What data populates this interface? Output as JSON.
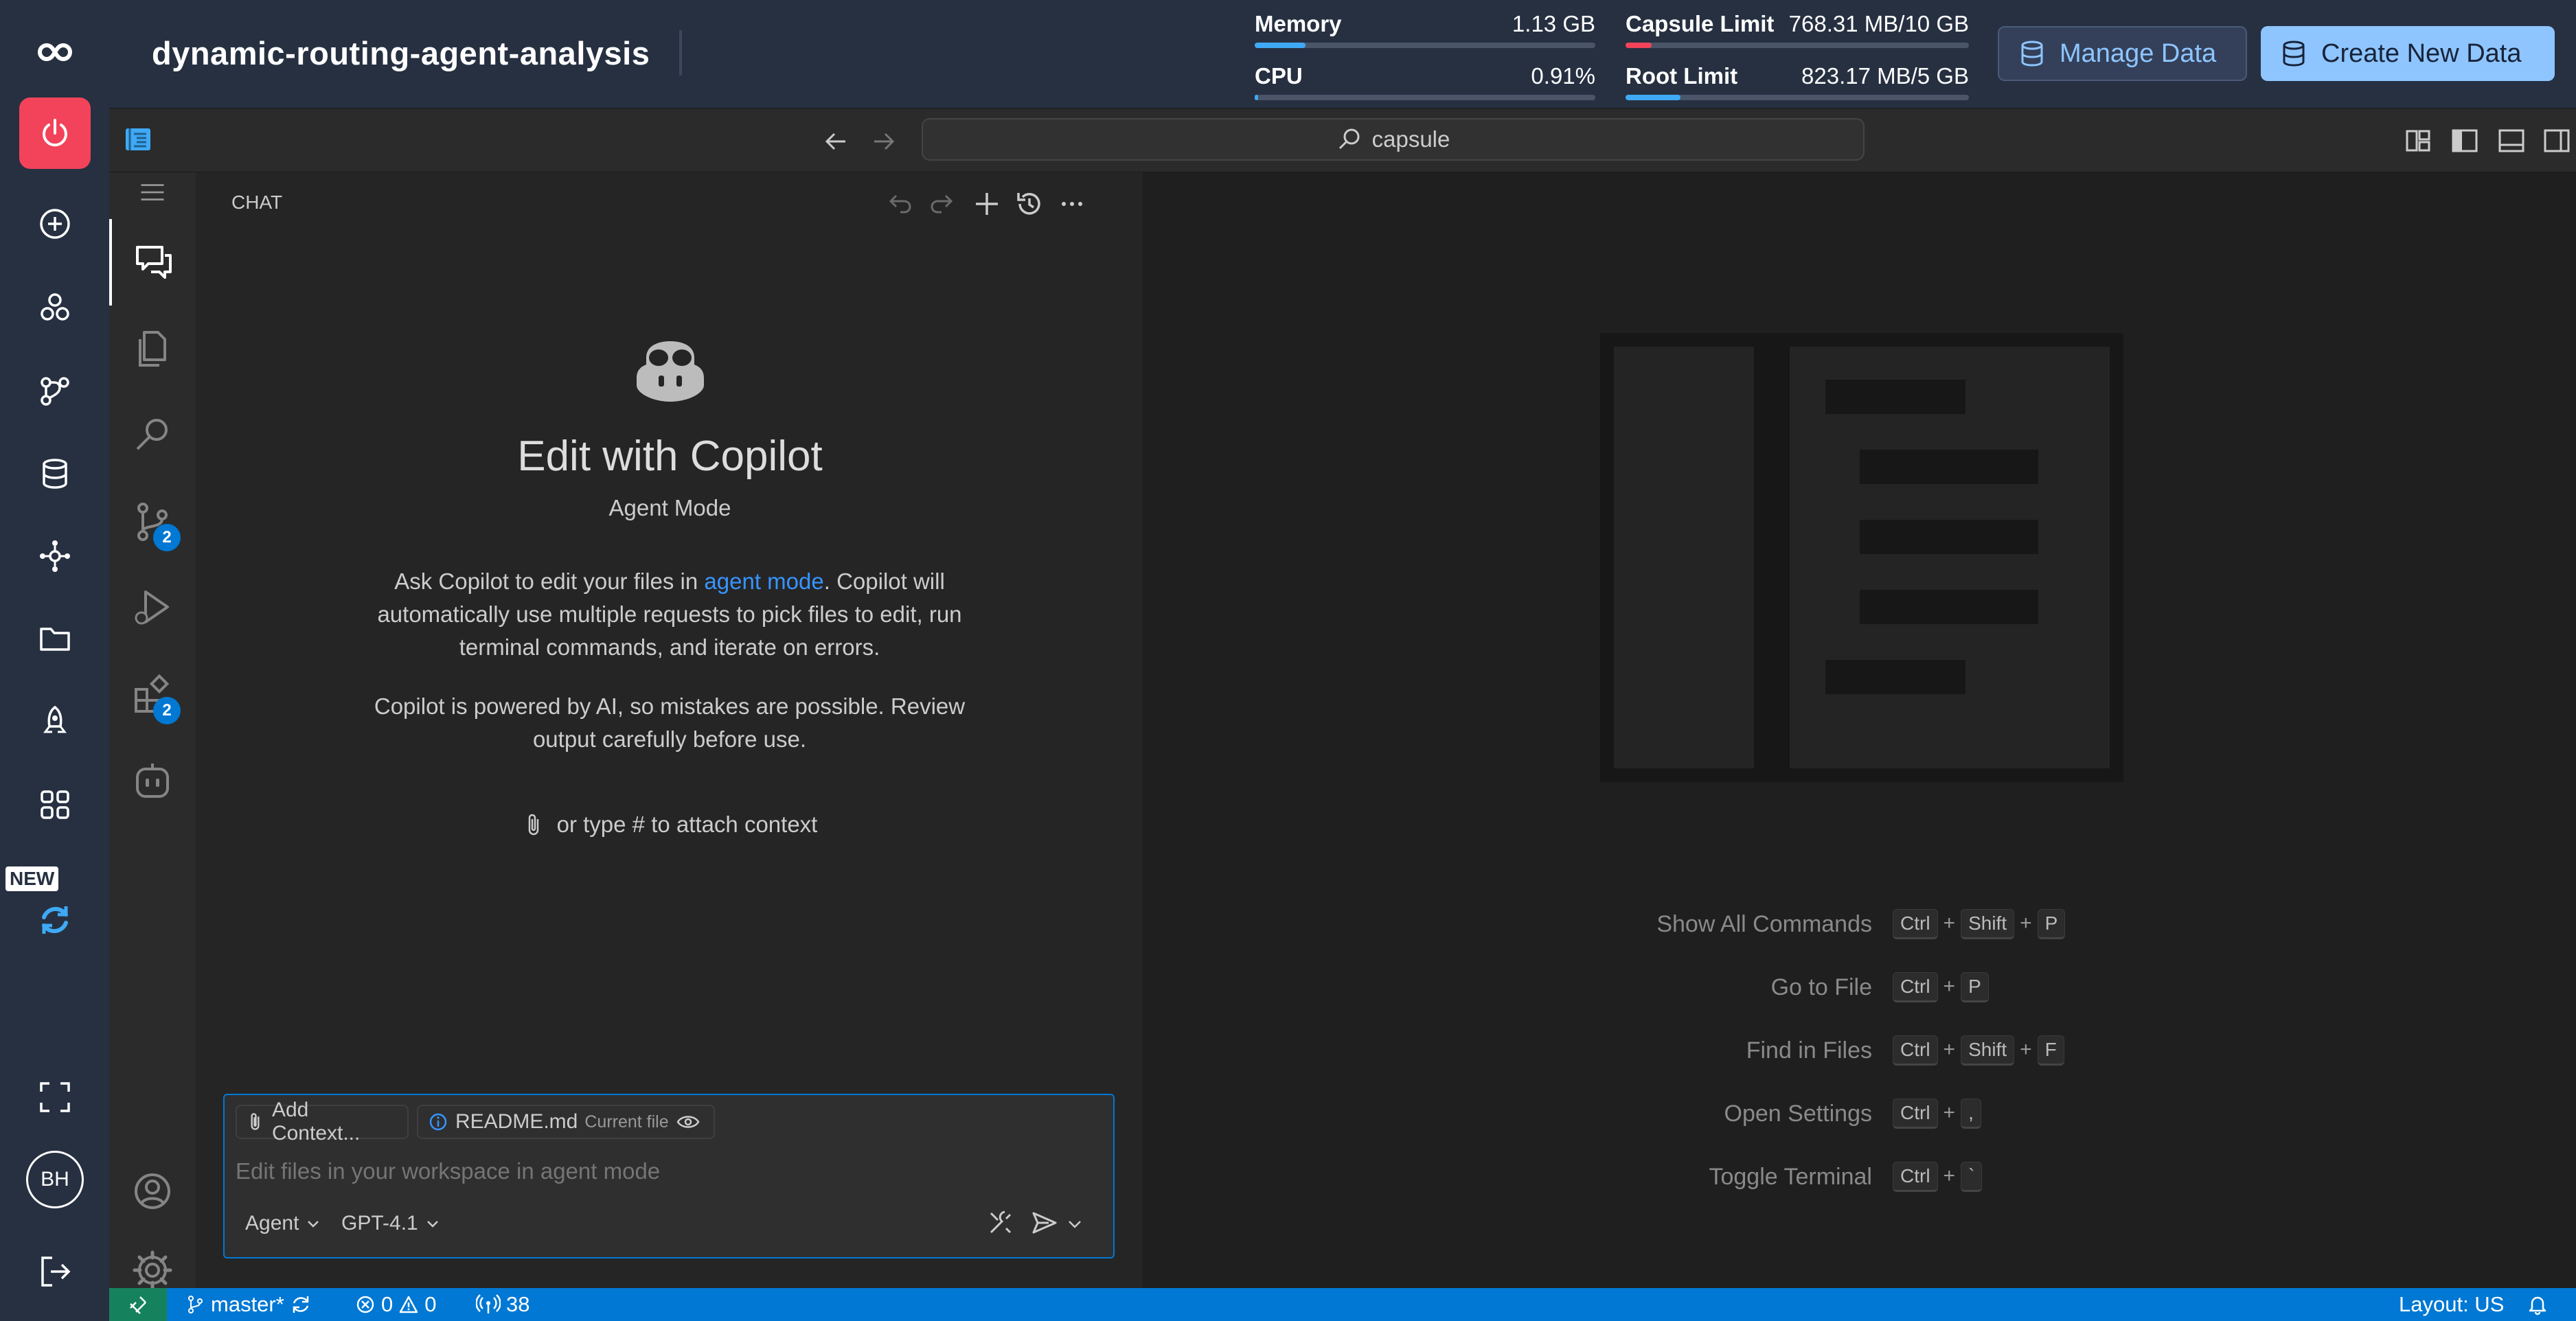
{
  "app": {
    "project_name": "dynamic-routing-agent-analysis"
  },
  "metrics": {
    "memory": {
      "label": "Memory",
      "value": "1.13 GB",
      "fraction": 0.15
    },
    "capsule": {
      "label": "Capsule Limit",
      "value": "768.31 MB/10 GB",
      "fraction": 0.075
    },
    "cpu": {
      "label": "CPU",
      "value": "0.91%",
      "fraction": 0.01
    },
    "root": {
      "label": "Root Limit",
      "value": "823.17 MB/5 GB",
      "fraction": 0.16
    }
  },
  "buttons": {
    "manage_data": "Manage Data",
    "create_new_data": "Create New Data"
  },
  "rail": {
    "new_badge": "NEW",
    "avatar_initials": "BH"
  },
  "titlebar": {
    "search_text": "capsule"
  },
  "activity_badges": {
    "source_control": "2",
    "extensions": "2"
  },
  "chat": {
    "header": "CHAT",
    "title": "Edit with Copilot",
    "mode": "Agent Mode",
    "desc_before": "Ask Copilot to edit your files in ",
    "desc_link": "agent mode",
    "desc_after": ". Copilot will automatically use multiple requests to pick files to edit, run terminal commands, and iterate on errors.",
    "disclaimer": "Copilot is powered by AI, so mistakes are possible. Review output carefully before use.",
    "attach_hint": "or type # to attach context",
    "add_context": "Add Context...",
    "current_file_name": "README.md",
    "current_file_label": "Current file",
    "input_placeholder": "Edit files in your workspace in agent mode",
    "mode_select": "Agent",
    "model_select": "GPT-4.1"
  },
  "shortcuts": [
    {
      "label": "Show All Commands",
      "keys": [
        "Ctrl",
        "Shift",
        "P"
      ]
    },
    {
      "label": "Go to File",
      "keys": [
        "Ctrl",
        "P"
      ]
    },
    {
      "label": "Find in Files",
      "keys": [
        "Ctrl",
        "Shift",
        "F"
      ]
    },
    {
      "label": "Open Settings",
      "keys": [
        "Ctrl",
        ","
      ]
    },
    {
      "label": "Toggle Terminal",
      "keys": [
        "Ctrl",
        "`"
      ]
    }
  ],
  "statusbar": {
    "branch": "master*",
    "errors": "0",
    "warnings": "0",
    "ports": "38",
    "layout": "Layout: US"
  },
  "colors": {
    "accent": "#0078d4",
    "rail_bg": "#263041",
    "power_button": "#f2435a",
    "create_button": "#8ec5ff"
  }
}
